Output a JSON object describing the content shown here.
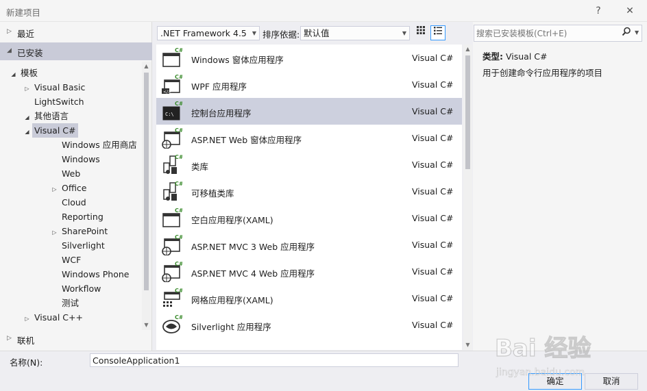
{
  "window": {
    "title": "新建项目",
    "help": "?",
    "close": "✕"
  },
  "left": {
    "recent": "最近",
    "installed": "已安装",
    "online": "联机",
    "tree": [
      {
        "label": "模板",
        "level": 0,
        "arrow": "◢",
        "selected": false
      },
      {
        "label": "Visual Basic",
        "level": 1,
        "arrow": "▷",
        "selected": false
      },
      {
        "label": "LightSwitch",
        "level": 1,
        "arrow": "",
        "selected": false
      },
      {
        "label": "其他语言",
        "level": 1,
        "arrow": "◢",
        "selected": false
      },
      {
        "label": "Visual C#",
        "level": 2,
        "arrow": "◢",
        "selected": true
      },
      {
        "label": "Windows 应用商店",
        "level": 3,
        "arrow": "",
        "selected": false
      },
      {
        "label": "Windows",
        "level": 3,
        "arrow": "",
        "selected": false
      },
      {
        "label": "Web",
        "level": 3,
        "arrow": "",
        "selected": false
      },
      {
        "label": "Office",
        "level": 3,
        "arrow": "▷",
        "selected": false
      },
      {
        "label": "Cloud",
        "level": 3,
        "arrow": "",
        "selected": false
      },
      {
        "label": "Reporting",
        "level": 3,
        "arrow": "",
        "selected": false
      },
      {
        "label": "SharePoint",
        "level": 3,
        "arrow": "▷",
        "selected": false
      },
      {
        "label": "Silverlight",
        "level": 3,
        "arrow": "",
        "selected": false
      },
      {
        "label": "WCF",
        "level": 3,
        "arrow": "",
        "selected": false
      },
      {
        "label": "Windows Phone",
        "level": 3,
        "arrow": "",
        "selected": false
      },
      {
        "label": "Workflow",
        "level": 3,
        "arrow": "",
        "selected": false
      },
      {
        "label": "测试",
        "level": 3,
        "arrow": "",
        "selected": false
      },
      {
        "label": "Visual C++",
        "level": 2,
        "arrow": "▷",
        "selected": false
      }
    ]
  },
  "toolbar": {
    "framework": ".NET Framework 4.5",
    "sort_label": "排序依据:",
    "sort_value": "默认值"
  },
  "templates": [
    {
      "name": "Windows 窗体应用程序",
      "lang": "Visual C#",
      "icon": "window",
      "selected": false
    },
    {
      "name": "WPF 应用程序",
      "lang": "Visual C#",
      "icon": "wpf",
      "selected": false
    },
    {
      "name": "控制台应用程序",
      "lang": "Visual C#",
      "icon": "console",
      "selected": true
    },
    {
      "name": "ASP.NET Web 窗体应用程序",
      "lang": "Visual C#",
      "icon": "globe",
      "selected": false
    },
    {
      "name": "类库",
      "lang": "Visual C#",
      "icon": "library",
      "selected": false
    },
    {
      "name": "可移植类库",
      "lang": "Visual C#",
      "icon": "library",
      "selected": false
    },
    {
      "name": "空白应用程序(XAML)",
      "lang": "Visual C#",
      "icon": "window",
      "selected": false
    },
    {
      "name": "ASP.NET MVC 3 Web 应用程序",
      "lang": "Visual C#",
      "icon": "globe",
      "selected": false
    },
    {
      "name": "ASP.NET MVC 4 Web 应用程序",
      "lang": "Visual C#",
      "icon": "globe",
      "selected": false
    },
    {
      "name": "网格应用程序(XAML)",
      "lang": "Visual C#",
      "icon": "grid",
      "selected": false
    },
    {
      "name": "Silverlight 应用程序",
      "lang": "Visual C#",
      "icon": "silverlight",
      "selected": false
    }
  ],
  "details": {
    "search_placeholder": "搜索已安装模板(Ctrl+E)",
    "type_label": "类型:",
    "type_value": "Visual C#",
    "description": "用于创建命令行应用程序的项目"
  },
  "footer": {
    "name_label": "名称(N):",
    "name_value": "ConsoleApplication1",
    "ok": "确定",
    "cancel": "取消"
  },
  "watermark": {
    "text": "Bai 经验",
    "sub": "jingyan.baidu.com"
  },
  "colors": {
    "selection": "#cdd0de",
    "accent": "#3399ff",
    "csharp_green": "#3a8b2c"
  }
}
